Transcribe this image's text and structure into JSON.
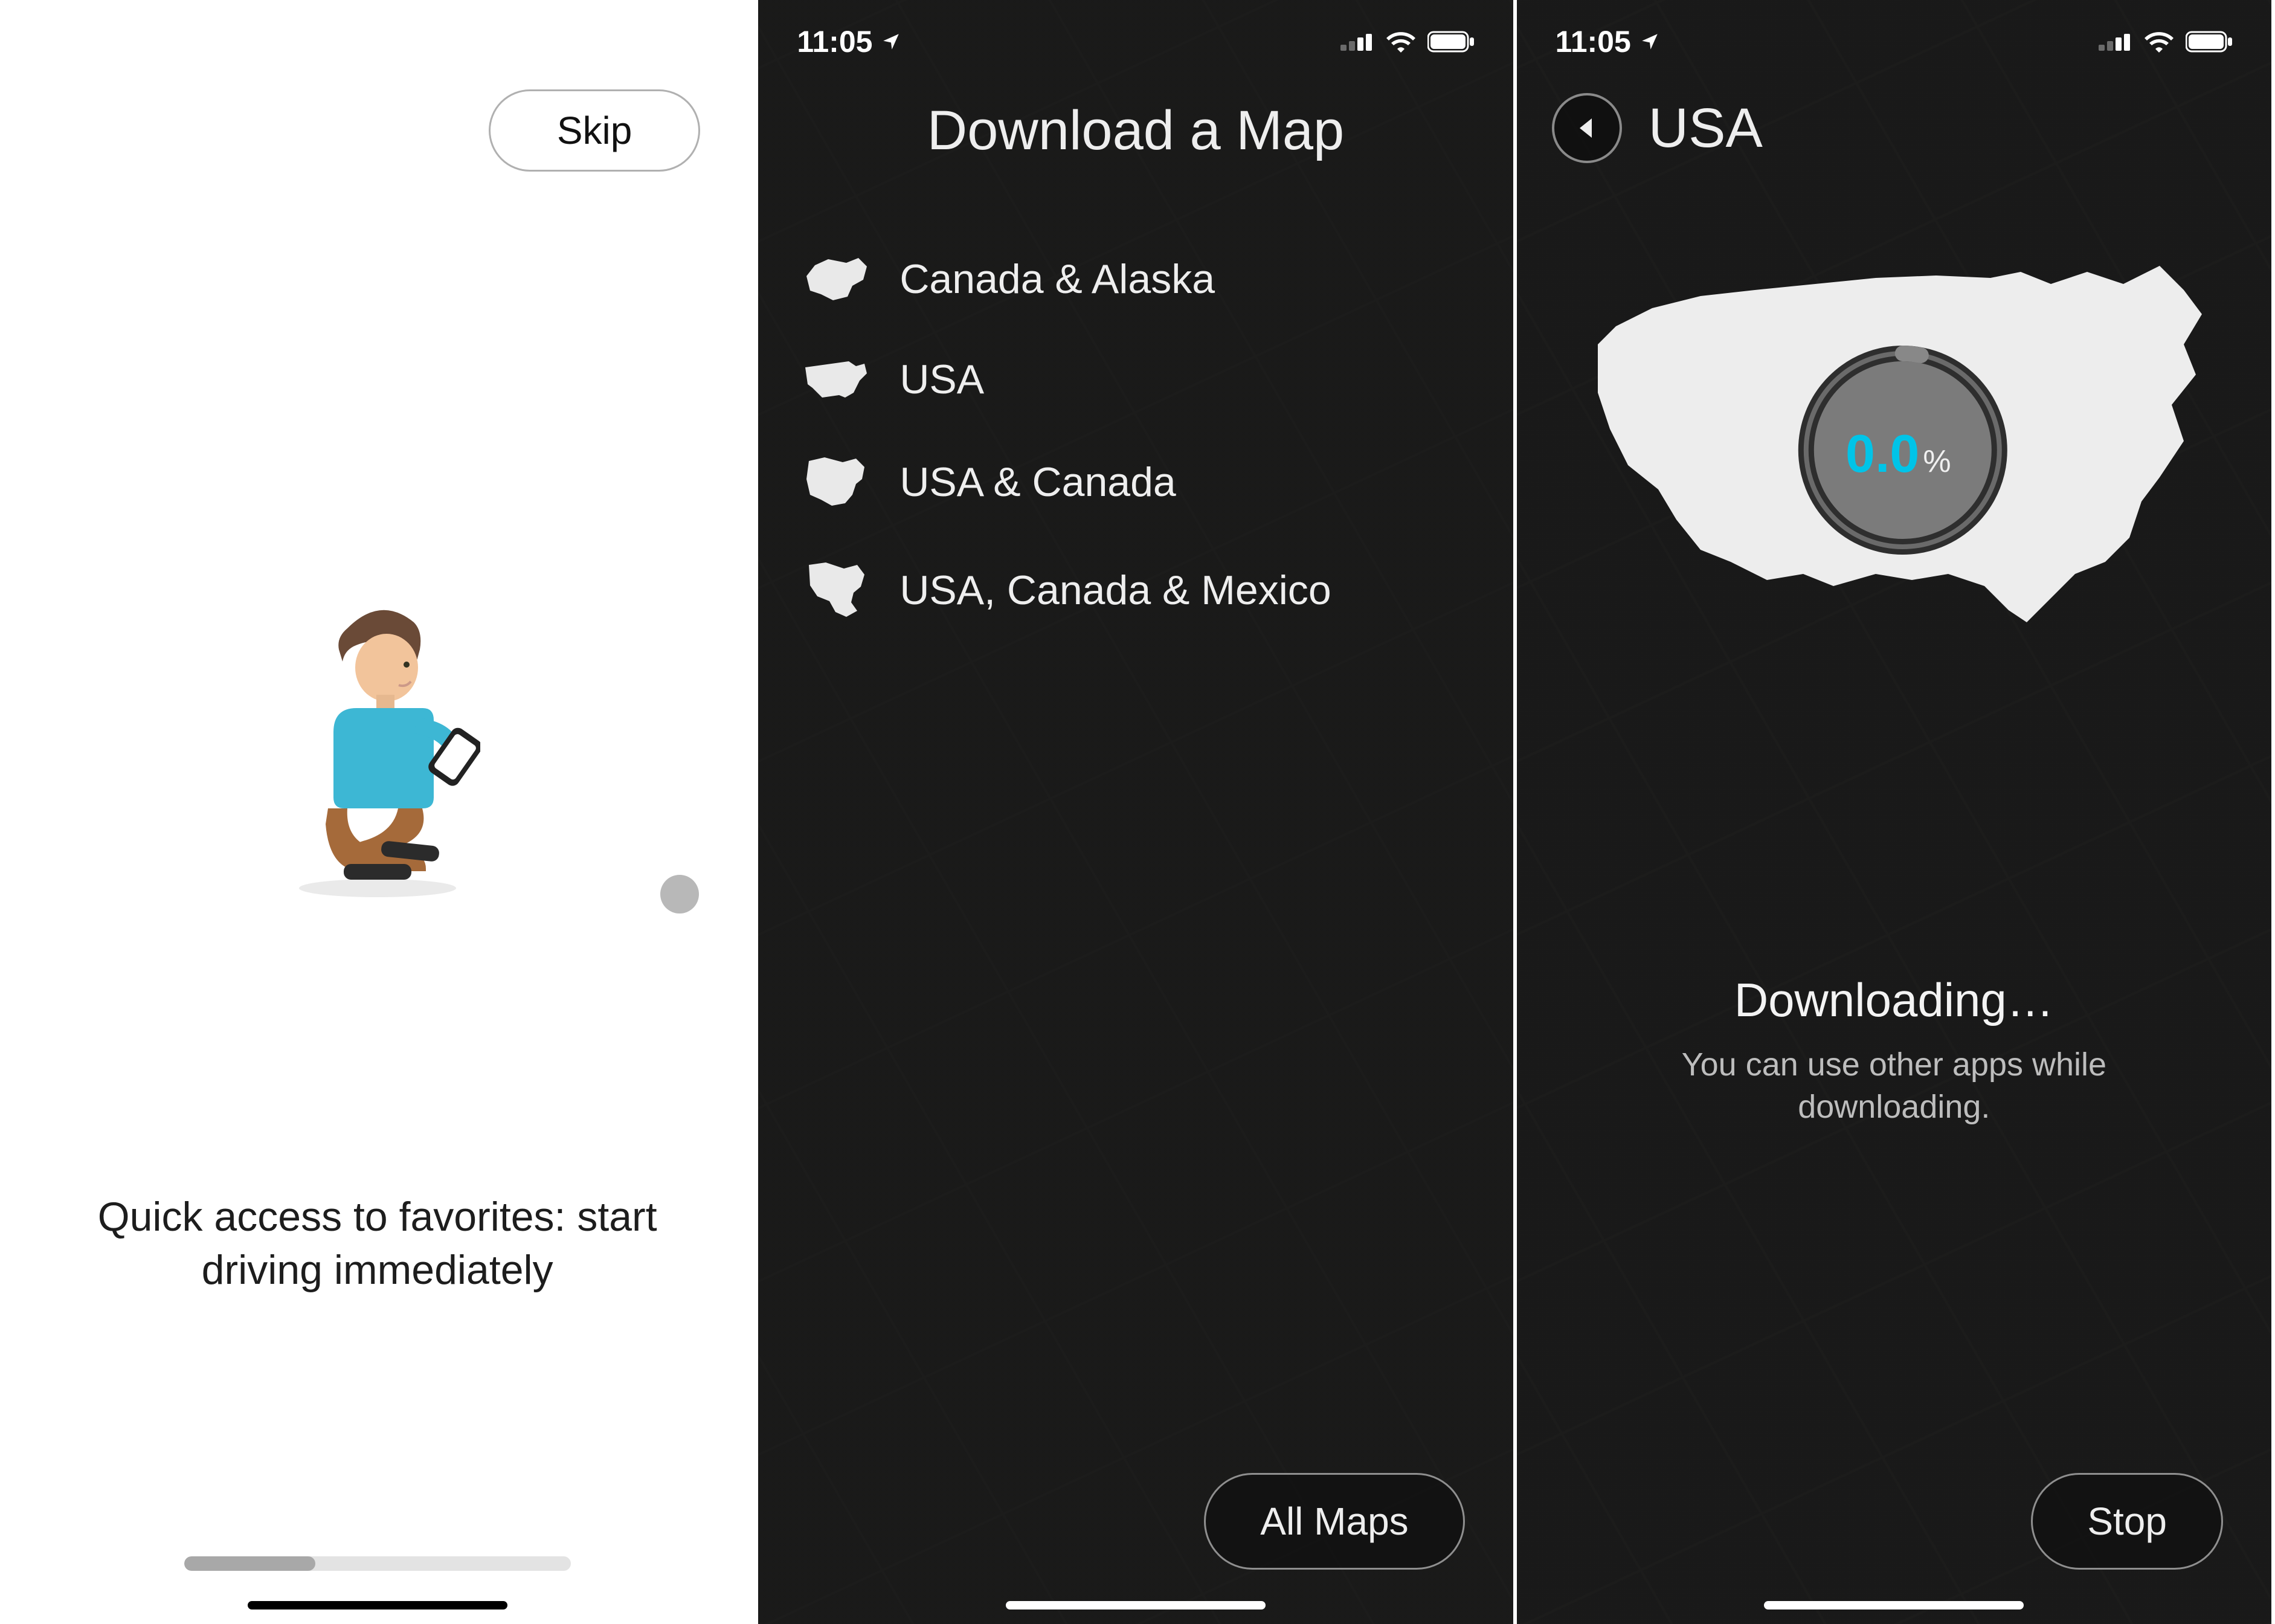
{
  "panel1": {
    "skip_label": "Skip",
    "caption": "Quick access to favorites: start driving immediately"
  },
  "panel2": {
    "status_time": "11:05",
    "title": "Download a Map",
    "items": [
      {
        "label": "Canada & Alaska"
      },
      {
        "label": "USA"
      },
      {
        "label": "USA & Canada"
      },
      {
        "label": "USA, Canada & Mexico"
      }
    ],
    "all_maps_label": "All Maps"
  },
  "panel3": {
    "status_time": "11:05",
    "title": "USA",
    "percent": "0.0",
    "percent_suffix": "%",
    "downloading_label": "Downloading…",
    "downloading_hint": "You can use other apps while downloading.",
    "stop_label": "Stop"
  }
}
